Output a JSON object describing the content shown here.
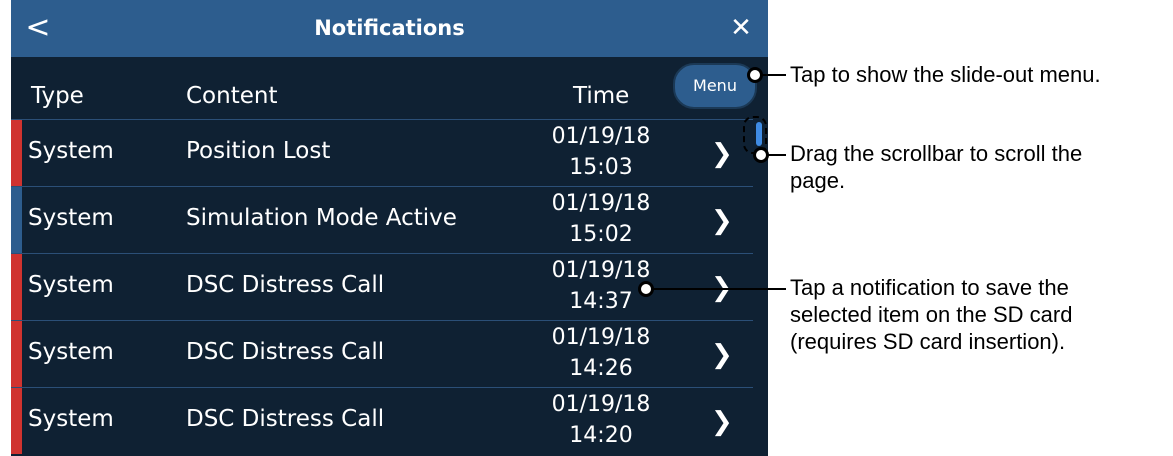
{
  "titlebar": {
    "back_icon": "<",
    "title": "Notifications",
    "close_icon": "✕"
  },
  "header": {
    "type": "Type",
    "content": "Content",
    "time": "Time"
  },
  "menu": {
    "label": "Menu"
  },
  "rows": [
    {
      "type": "System",
      "content": "Position Lost",
      "date": "01/19/18",
      "time": "15:03",
      "color": "#d0332f"
    },
    {
      "type": "System",
      "content": "Simulation Mode Active",
      "date": "01/19/18",
      "time": "15:02",
      "color": "#2d5d8e"
    },
    {
      "type": "System",
      "content": "DSC Distress Call",
      "date": "01/19/18",
      "time": "14:37",
      "color": "#d0332f"
    },
    {
      "type": "System",
      "content": "DSC Distress Call",
      "date": "01/19/18",
      "time": "14:26",
      "color": "#d0332f"
    },
    {
      "type": "System",
      "content": "DSC Distress Call",
      "date": "01/19/18",
      "time": "14:20",
      "color": "#d0332f"
    }
  ],
  "chevron_icon": "❯",
  "callouts": {
    "menu": "Tap to show the slide-out menu.",
    "scrollbar_line1": "Drag the scrollbar to scroll the",
    "scrollbar_line2": "page.",
    "notification_line1": "Tap a notification to save the",
    "notification_line2": "selected item on the SD card",
    "notification_line3": "(requires SD card insertion)."
  }
}
